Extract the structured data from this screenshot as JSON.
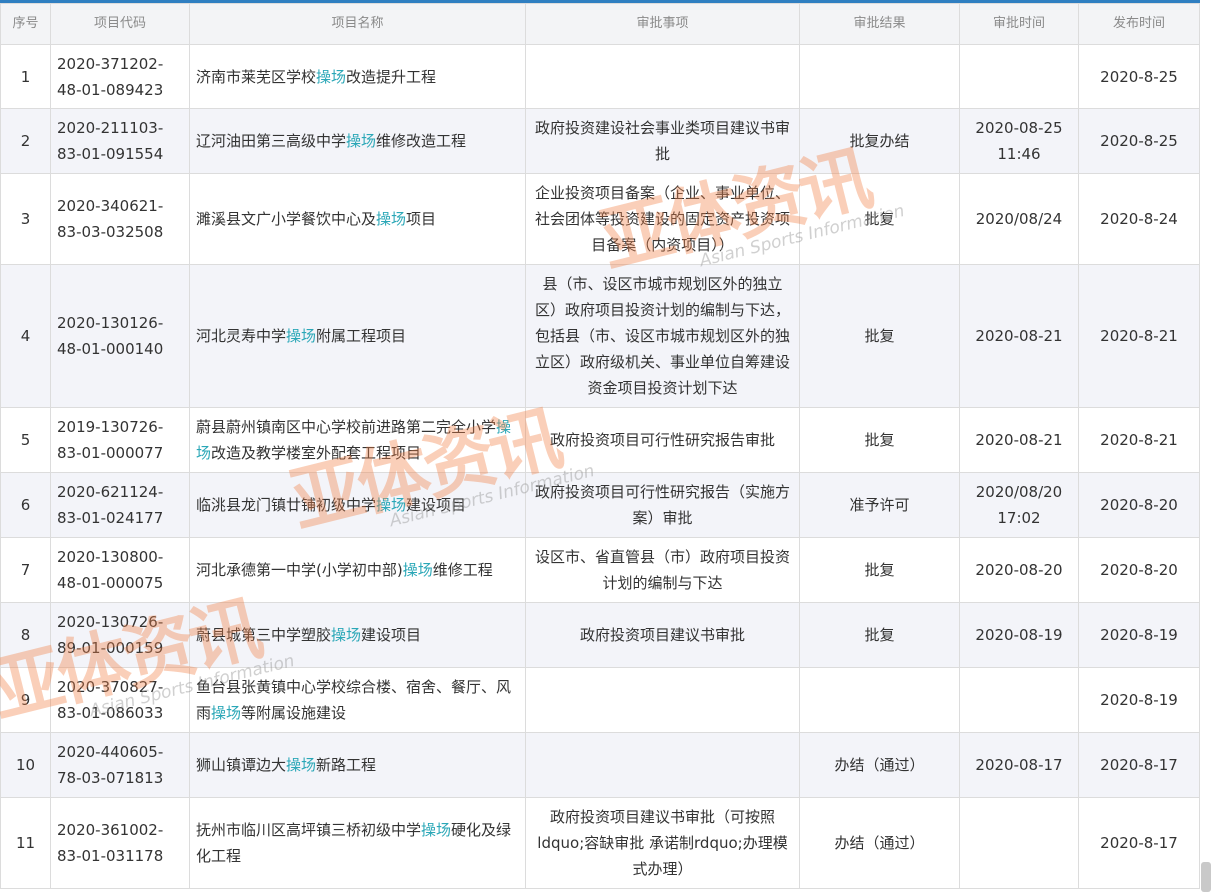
{
  "headers": [
    "序号",
    "项目代码",
    "项目名称",
    "审批事项",
    "审批结果",
    "审批时间",
    "发布时间"
  ],
  "highlight_term": "操场",
  "rows": [
    {
      "no": "1",
      "code": "2020-371202-48-01-089423",
      "name_pre": "济南市莱芜区学校",
      "name_hl": "操场",
      "name_post": "改造提升工程",
      "item": "",
      "result": "",
      "time": "",
      "pub": "2020-8-25"
    },
    {
      "no": "2",
      "code": "2020-211103-83-01-091554",
      "name_pre": "辽河油田第三高级中学",
      "name_hl": "操场",
      "name_post": "维修改造工程",
      "item": "政府投资建设社会事业类项目建议书审批",
      "result": "批复办结",
      "time": "2020-08-25 11:46",
      "pub": "2020-8-25"
    },
    {
      "no": "3",
      "code": "2020-340621-83-03-032508",
      "name_pre": "濉溪县文广小学餐饮中心及",
      "name_hl": "操场",
      "name_post": "项目",
      "item": "企业投资项目备案（企业、事业单位、社会团体等投资建设的固定资产投资项目备案（内资项目））",
      "result": "批复",
      "time": "2020/08/24",
      "pub": "2020-8-24"
    },
    {
      "no": "4",
      "code": "2020-130126-48-01-000140",
      "name_pre": "河北灵寿中学",
      "name_hl": "操场",
      "name_post": "附属工程项目",
      "item": "县（市、设区市城市规划区外的独立区）政府项目投资计划的编制与下达，包括县（市、设区市城市规划区外的独立区）政府级机关、事业单位自筹建设资金项目投资计划下达",
      "result": "批复",
      "time": "2020-08-21",
      "pub": "2020-8-21"
    },
    {
      "no": "5",
      "code": "2019-130726-83-01-000077",
      "name_pre": "蔚县蔚州镇南区中心学校前进路第二完全小学",
      "name_hl": "操场",
      "name_post": "改造及教学楼室外配套工程项目",
      "item": "政府投资项目可行性研究报告审批",
      "result": "批复",
      "time": "2020-08-21",
      "pub": "2020-8-21"
    },
    {
      "no": "6",
      "code": "2020-621124-83-01-024177",
      "name_pre": "临洮县龙门镇廿铺初级中学",
      "name_hl": "操场",
      "name_post": "建设项目",
      "item": "政府投资项目可行性研究报告（实施方案）审批",
      "result": "准予许可",
      "time": "2020/08/20 17:02",
      "pub": "2020-8-20"
    },
    {
      "no": "7",
      "code": "2020-130800-48-01-000075",
      "name_pre": "河北承德第一中学(小学初中部)",
      "name_hl": "操场",
      "name_post": "维修工程",
      "item": "设区市、省直管县（市）政府项目投资计划的编制与下达",
      "result": "批复",
      "time": "2020-08-20",
      "pub": "2020-8-20"
    },
    {
      "no": "8",
      "code": "2020-130726-89-01-000159",
      "name_pre": "蔚县城第三中学塑胶",
      "name_hl": "操场",
      "name_post": "建设项目",
      "item": "政府投资项目建议书审批",
      "result": "批复",
      "time": "2020-08-19",
      "pub": "2020-8-19"
    },
    {
      "no": "9",
      "code": "2020-370827-83-01-086033",
      "name_pre": "鱼台县张黄镇中心学校综合楼、宿舍、餐厅、风雨",
      "name_hl": "操场",
      "name_post": "等附属设施建设",
      "item": "",
      "result": "",
      "time": "",
      "pub": "2020-8-19"
    },
    {
      "no": "10",
      "code": "2020-440605-78-03-071813",
      "name_pre": "狮山镇谭边大",
      "name_hl": "操场",
      "name_post": "新路工程",
      "item": "",
      "result": "办结（通过）",
      "time": "2020-08-17",
      "pub": "2020-8-17"
    },
    {
      "no": "11",
      "code": "2020-361002-83-01-031178",
      "name_pre": "抚州市临川区高坪镇三桥初级中学",
      "name_hl": "操场",
      "name_post": "硬化及绿化工程",
      "item": "政府投资项目建议书审批（可按照ldquo;容缺审批 承诺制rdquo;办理模式办理）",
      "result": "办结（通过）",
      "time": "",
      "pub": "2020-8-17"
    }
  ],
  "watermark": {
    "logo": "亚体资讯",
    "sub": "Asian Sports Information"
  }
}
